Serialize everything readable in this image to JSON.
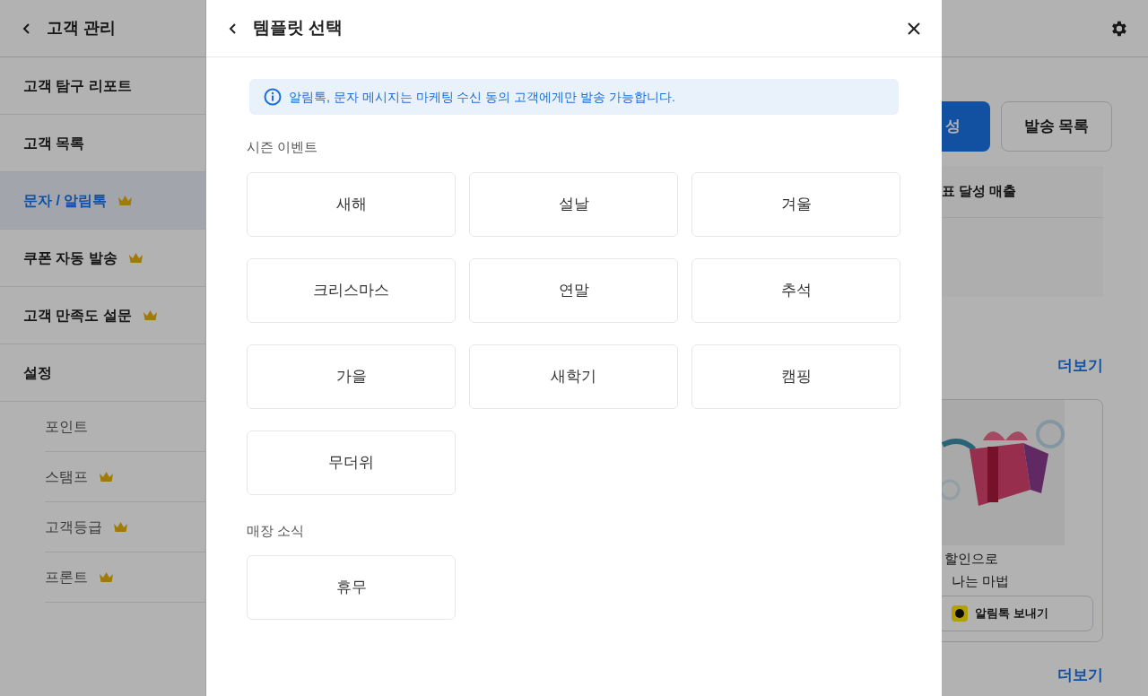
{
  "sidebar": {
    "title": "고객 관리",
    "items": [
      {
        "label": "고객 탐구 리포트",
        "premium": false,
        "selected": false
      },
      {
        "label": "고객 목록",
        "premium": false,
        "selected": false
      },
      {
        "label": "문자 / 알림톡",
        "premium": true,
        "selected": true
      },
      {
        "label": "쿠폰 자동 발송",
        "premium": true,
        "selected": false
      },
      {
        "label": "고객 만족도 설문",
        "premium": true,
        "selected": false
      },
      {
        "label": "설정",
        "premium": false,
        "selected": false,
        "children": [
          {
            "label": "포인트",
            "premium": false,
            "selected": false
          },
          {
            "label": "스탬프",
            "premium": true,
            "selected": false
          },
          {
            "label": "고객등급",
            "premium": true,
            "selected": false
          },
          {
            "label": "프론트",
            "premium": true,
            "selected": false
          }
        ]
      }
    ]
  },
  "main": {
    "buttons": [
      {
        "label": "성",
        "kind": "primary"
      },
      {
        "label": "발송 목록",
        "kind": "secondary"
      }
    ],
    "table": {
      "columns": [
        "표 달성 매출"
      ]
    },
    "more_links": [
      "더보기",
      "더보기"
    ],
    "card": {
      "lines": [
        "할인으로",
        "나는 마법"
      ],
      "button": "알림톡 보내기"
    }
  },
  "modal": {
    "title": "템플릿 선택",
    "notice": "알림톡, 문자 메시지는 마케팅 수신 동의 고객에게만 발송 가능합니다.",
    "sections": [
      {
        "title": "시즌 이벤트",
        "templates": [
          "새해",
          "설날",
          "겨울",
          "크리스마스",
          "연말",
          "추석",
          "가을",
          "새학기",
          "캠핑",
          "무더위"
        ]
      },
      {
        "title": "매장 소식",
        "templates": [
          "휴무"
        ]
      }
    ]
  }
}
